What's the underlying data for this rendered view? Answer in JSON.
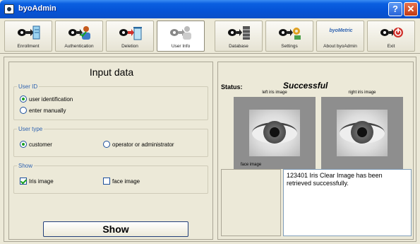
{
  "window": {
    "title": "byoAdmin"
  },
  "toolbar": {
    "items": [
      {
        "label": "Enrollment",
        "icon": "enrollment-icon"
      },
      {
        "label": "Authentication",
        "icon": "authentication-icon"
      },
      {
        "label": "Deletion",
        "icon": "deletion-icon"
      },
      {
        "label": "User Info",
        "icon": "user-info-icon",
        "active": true
      },
      {
        "label": "Database",
        "icon": "database-icon"
      },
      {
        "label": "Settings",
        "icon": "settings-icon"
      },
      {
        "label": "About byoAdmin",
        "icon": "about-icon",
        "logo_text": "byoMetric"
      },
      {
        "label": "Exit",
        "icon": "exit-icon"
      }
    ]
  },
  "input_panel": {
    "title": "Input data",
    "user_id": {
      "title": "User ID",
      "options": [
        {
          "label": "user identification",
          "selected": true
        },
        {
          "label": "enter manually",
          "selected": false
        }
      ]
    },
    "user_type": {
      "title": "User type",
      "options": [
        {
          "label": "customer",
          "selected": true
        },
        {
          "label": "operator or administrator",
          "selected": false
        }
      ]
    },
    "show": {
      "title": "Show",
      "options": [
        {
          "label": "Iris image",
          "checked": true
        },
        {
          "label": "face image",
          "checked": false
        }
      ]
    },
    "show_button": "Show"
  },
  "result_panel": {
    "status_label": "Status:",
    "status_value": "Successful",
    "left_iris_label": "left iris image",
    "right_iris_label": "right iris image",
    "face_label": "face image",
    "message": "123401 Iris Clear Image has been retrieved successfully."
  },
  "colors": {
    "titlebar": "#0553d6",
    "group_title": "#2e62b0",
    "radio_dot": "#1aa020"
  }
}
